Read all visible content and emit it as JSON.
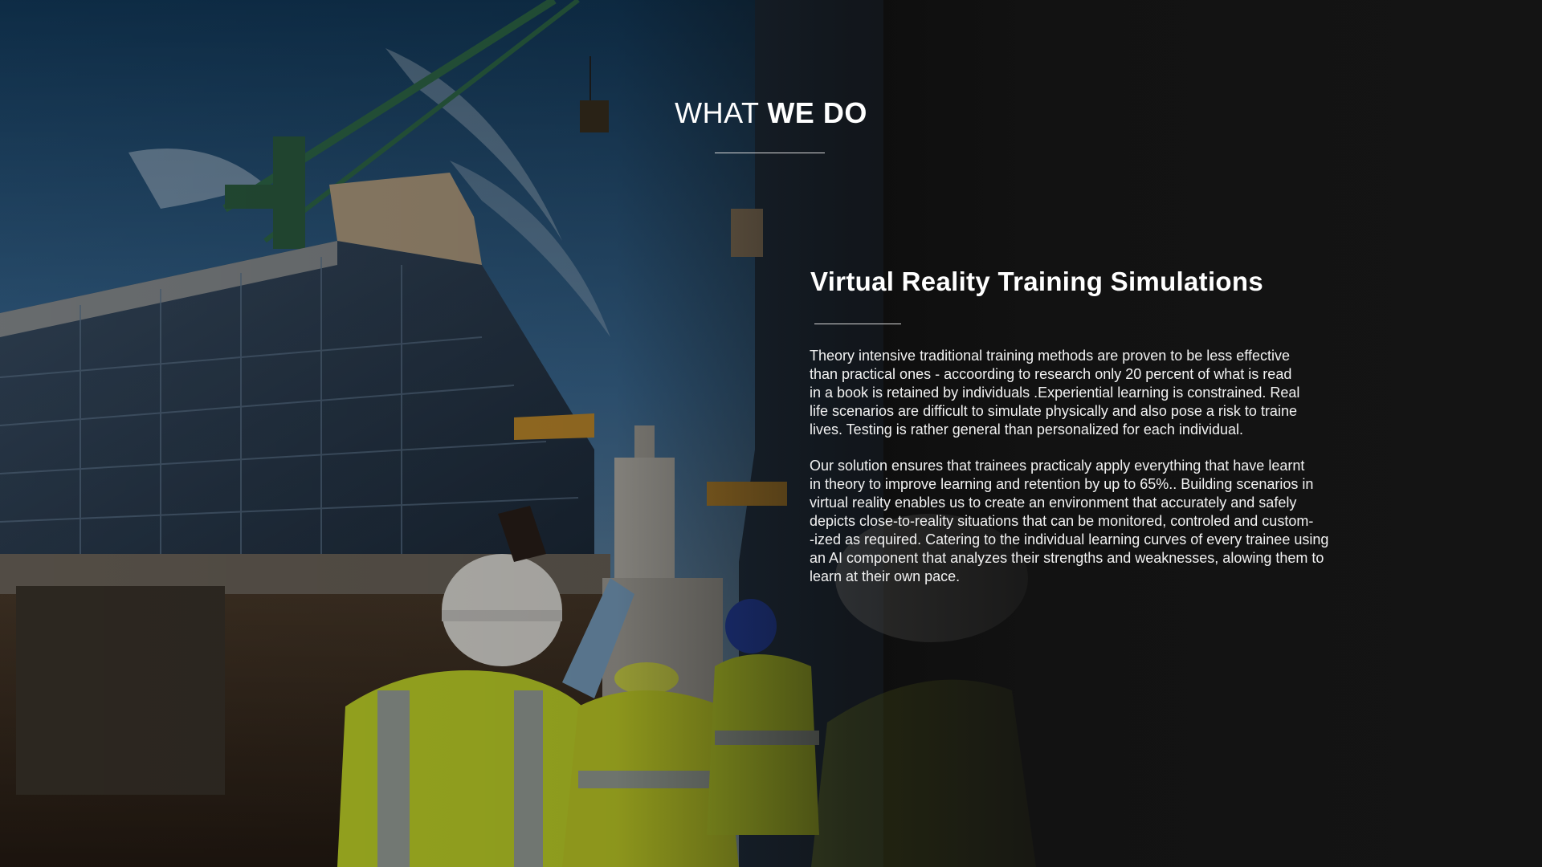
{
  "header": {
    "title_light": "WHAT ",
    "title_bold": "WE DO"
  },
  "section": {
    "title": "Virtual Reality Training Simulations",
    "paragraph_1": [
      "Theory intensive traditional training methods are proven to be less effective",
      "than practical ones - accoording to research only 20 percent of what is read",
      "in a book is retained by individuals .Experiential learning is constrained. Real",
      "life scenarios are difficult to simulate physically and also pose a risk to traine",
      "lives. Testing is rather general than personalized for each individual."
    ],
    "paragraph_2": [
      "Our solution ensures that trainees practicaly apply everything that have learnt",
      "in theory to improve learning and retention by up to 65%.. Building scenarios in",
      "virtual reality enables us to create an environment that accurately and safely",
      "depicts close-to-reality situations that can be monitored, controled and custom-",
      "-ized as required. Catering to the individual learning curves of every trainee using",
      "an AI component that analyzes their strengths and weaknesses, alowing them to",
      "learn at their own pace."
    ]
  },
  "colors": {
    "text": "#ffffff",
    "background": "#161616",
    "vest": "#c9dd2a",
    "sky": "#2f5a86"
  }
}
